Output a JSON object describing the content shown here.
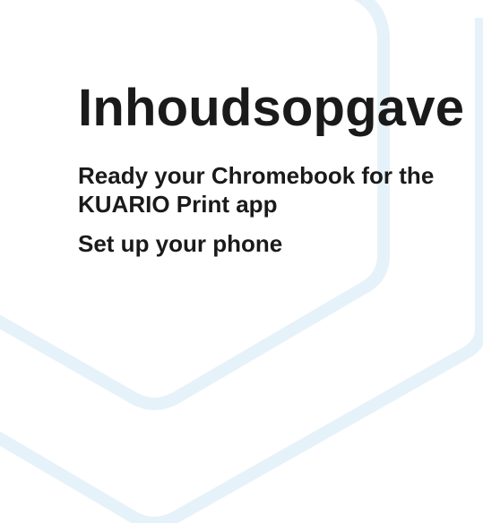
{
  "toc": {
    "title": "Inhoudsopgave",
    "items": [
      {
        "label_line1": "Ready your Chromebook for the",
        "label_line2": "KUARIO Print app"
      },
      {
        "label_line1": "Set up your phone"
      }
    ]
  },
  "colors": {
    "background": "#ffffff",
    "text": "#1a1a1a",
    "hexagon_outline": "#e6f2f9"
  }
}
